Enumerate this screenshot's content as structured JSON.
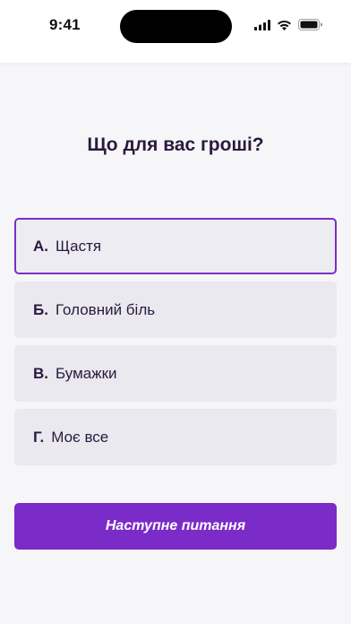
{
  "status_bar": {
    "time": "9:41",
    "icons": [
      "cellular-signal-icon",
      "wifi-icon",
      "battery-icon"
    ]
  },
  "quiz": {
    "question": "Що для вас гроші?",
    "answers": [
      {
        "letter": "А.",
        "text": "Щастя",
        "selected": true
      },
      {
        "letter": "Б.",
        "text": "Головний біль",
        "selected": false
      },
      {
        "letter": "В.",
        "text": "Бумажки",
        "selected": false
      },
      {
        "letter": "Г.",
        "text": "Моє все",
        "selected": false
      }
    ],
    "next_button_label": "Наступне питання"
  },
  "colors": {
    "accent": "#7b2bc8",
    "selected_border": "#7a2fc4",
    "answer_bg": "#e9e9ef",
    "text": "#2a1a3d",
    "page_bg": "#f6f6f8"
  }
}
